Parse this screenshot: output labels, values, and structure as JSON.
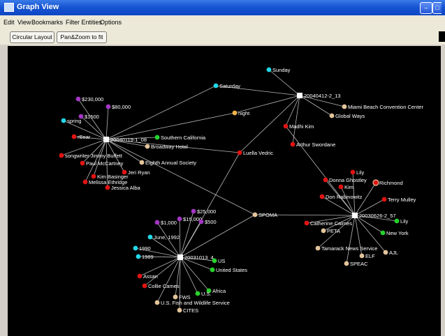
{
  "window": {
    "title": "Graph View"
  },
  "menu": [
    "Edit",
    "View",
    "Bookmarks",
    "Filter Entities",
    "Options"
  ],
  "toolbar": {
    "circular_layout": "Circular Layout",
    "pan_zoom": "Pan&Zoom to fit"
  },
  "colors": {
    "background": "#000000",
    "edge": "#b8b8b8",
    "hub": "#ffffff",
    "cyan": "#22d8e8",
    "purple": "#a336c4",
    "red": "#e01414",
    "green": "#27d22b",
    "tan": "#e3c49a",
    "orange": "#f2b24c"
  },
  "graph": {
    "hubs": [
      {
        "id": "h1",
        "label": "20040119-1_08"
      },
      {
        "id": "h2",
        "label": "20040412-2_13"
      },
      {
        "id": "h3",
        "label": "20031013_4"
      },
      {
        "id": "h4",
        "label": "20030626-2_57"
      }
    ],
    "nodes": [
      {
        "id": "n1",
        "label": "$230,000",
        "color": "purple"
      },
      {
        "id": "n2",
        "label": "$80,000",
        "color": "purple"
      },
      {
        "id": "n3",
        "label": "$1500",
        "color": "purple"
      },
      {
        "id": "n4",
        "label": "spring",
        "color": "cyan"
      },
      {
        "id": "n5",
        "label": "rBear",
        "color": "red"
      },
      {
        "id": "n6",
        "label": "Southern California",
        "color": "green"
      },
      {
        "id": "n7",
        "label": "Broadway Hotel",
        "color": "tan"
      },
      {
        "id": "n8",
        "label": "songwriter Jimmy Buffett",
        "color": "red"
      },
      {
        "id": "n9",
        "label": "Paul McCartney",
        "color": "red"
      },
      {
        "id": "n10",
        "label": "Eighth Annual Society",
        "color": "tan"
      },
      {
        "id": "n11",
        "label": "Jeri Ryan",
        "color": "red"
      },
      {
        "id": "n12",
        "label": "Kim Basinger",
        "color": "red"
      },
      {
        "id": "n13",
        "label": "Melissa Ethridge",
        "color": "red"
      },
      {
        "id": "n14",
        "label": "Jessica Alba",
        "color": "red"
      },
      {
        "id": "n15",
        "label": "Saturday",
        "color": "cyan"
      },
      {
        "id": "n16",
        "label": "Sunday",
        "color": "cyan"
      },
      {
        "id": "n17",
        "label": "night",
        "color": "orange"
      },
      {
        "id": "n18",
        "label": "Miami Beach Convention Center",
        "color": "tan"
      },
      {
        "id": "n19",
        "label": "Global Ways",
        "color": "tan"
      },
      {
        "id": "n20",
        "label": "Madhi Kim",
        "color": "red"
      },
      {
        "id": "n21",
        "label": "Arthur Swordane",
        "color": "red"
      },
      {
        "id": "n22",
        "label": "Luella Vedric",
        "color": "red"
      },
      {
        "id": "n23",
        "label": "SPOMA",
        "color": "tan"
      },
      {
        "id": "n24",
        "label": "$25,000",
        "color": "purple"
      },
      {
        "id": "n25",
        "label": "$15,000",
        "color": "purple"
      },
      {
        "id": "n26",
        "label": "$500",
        "color": "purple"
      },
      {
        "id": "n27",
        "label": "$1,000",
        "color": "purple"
      },
      {
        "id": "n28",
        "label": "June, 1992",
        "color": "cyan"
      },
      {
        "id": "n29",
        "label": "1990",
        "color": "cyan"
      },
      {
        "id": "n30",
        "label": "1989",
        "color": "cyan"
      },
      {
        "id": "n31",
        "label": "US",
        "color": "green"
      },
      {
        "id": "n32",
        "label": "United States",
        "color": "green"
      },
      {
        "id": "n33",
        "label": "Assan",
        "color": "red"
      },
      {
        "id": "n34",
        "label": "Collie Cames",
        "color": "red"
      },
      {
        "id": "n35",
        "label": "Africa",
        "color": "green"
      },
      {
        "id": "n36",
        "label": "U.S.",
        "color": "green"
      },
      {
        "id": "n37",
        "label": "FWS",
        "color": "tan"
      },
      {
        "id": "n38",
        "label": "U.S. Fish and Wildlife Service",
        "color": "tan"
      },
      {
        "id": "n39",
        "label": "CITES",
        "color": "tan"
      },
      {
        "id": "n40",
        "label": "Lily",
        "color": "red"
      },
      {
        "id": "n41",
        "label": "Donna Ghostley",
        "color": "red"
      },
      {
        "id": "n42",
        "label": "Kim",
        "color": "red"
      },
      {
        "id": "n43",
        "label": "Richmond",
        "color": "red"
      },
      {
        "id": "n44",
        "label": "Don Rabinowitz",
        "color": "red"
      },
      {
        "id": "n45",
        "label": "Terry Mulley",
        "color": "red"
      },
      {
        "id": "n46",
        "label": "Lily",
        "color": "green"
      },
      {
        "id": "n47",
        "label": "Catherine Caimes",
        "color": "red"
      },
      {
        "id": "n48",
        "label": "PETA",
        "color": "tan"
      },
      {
        "id": "n49",
        "label": "New York",
        "color": "green"
      },
      {
        "id": "n50",
        "label": "Tamarack News Service",
        "color": "tan"
      },
      {
        "id": "n51",
        "label": "ELF",
        "color": "tan"
      },
      {
        "id": "n52",
        "label": "AJL",
        "color": "tan"
      },
      {
        "id": "n53",
        "label": "SPEAC",
        "color": "tan"
      }
    ],
    "edges": [
      [
        "h1",
        "n1"
      ],
      [
        "h1",
        "n2"
      ],
      [
        "h1",
        "n3"
      ],
      [
        "h1",
        "n4"
      ],
      [
        "h1",
        "n5"
      ],
      [
        "h1",
        "n6"
      ],
      [
        "h1",
        "n7"
      ],
      [
        "h1",
        "n8"
      ],
      [
        "h1",
        "n9"
      ],
      [
        "h1",
        "n10"
      ],
      [
        "h1",
        "n11"
      ],
      [
        "h1",
        "n12"
      ],
      [
        "h1",
        "n13"
      ],
      [
        "h1",
        "n14"
      ],
      [
        "h1",
        "n15"
      ],
      [
        "h1",
        "n17"
      ],
      [
        "h1",
        "n22"
      ],
      [
        "h1",
        "n23"
      ],
      [
        "h2",
        "n16"
      ],
      [
        "h2",
        "n15"
      ],
      [
        "h2",
        "n17"
      ],
      [
        "h2",
        "n18"
      ],
      [
        "h2",
        "n19"
      ],
      [
        "h2",
        "n20"
      ],
      [
        "h2",
        "n21"
      ],
      [
        "h2",
        "n22"
      ],
      [
        "h3",
        "n22"
      ],
      [
        "h3",
        "n23"
      ],
      [
        "h3",
        "n24"
      ],
      [
        "h3",
        "n25"
      ],
      [
        "h3",
        "n26"
      ],
      [
        "h3",
        "n27"
      ],
      [
        "h3",
        "n28"
      ],
      [
        "h3",
        "n29"
      ],
      [
        "h3",
        "n30"
      ],
      [
        "h3",
        "n31"
      ],
      [
        "h3",
        "n32"
      ],
      [
        "h3",
        "n33"
      ],
      [
        "h3",
        "n34"
      ],
      [
        "h3",
        "n35"
      ],
      [
        "h3",
        "n36"
      ],
      [
        "h3",
        "n37"
      ],
      [
        "h3",
        "n38"
      ],
      [
        "h3",
        "n39"
      ],
      [
        "h4",
        "n23"
      ],
      [
        "h4",
        "n20"
      ],
      [
        "h4",
        "n40"
      ],
      [
        "h4",
        "n41"
      ],
      [
        "h4",
        "n42"
      ],
      [
        "h4",
        "n43"
      ],
      [
        "h4",
        "n44"
      ],
      [
        "h4",
        "n45"
      ],
      [
        "h4",
        "n46"
      ],
      [
        "h4",
        "n47"
      ],
      [
        "h4",
        "n48"
      ],
      [
        "h4",
        "n49"
      ],
      [
        "h4",
        "n50"
      ],
      [
        "h4",
        "n51"
      ],
      [
        "h4",
        "n52"
      ],
      [
        "h4",
        "n53"
      ]
    ]
  }
}
